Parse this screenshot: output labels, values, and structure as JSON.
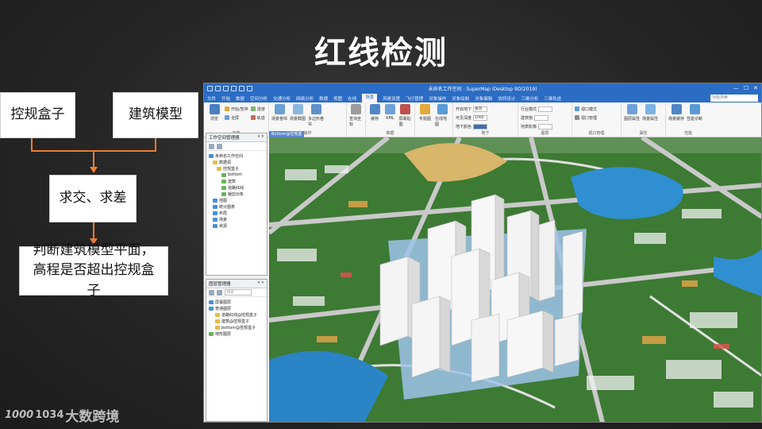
{
  "slide": {
    "title": "红线检测"
  },
  "flowchart": {
    "box_left": "控规盒子",
    "box_right": "建筑模型",
    "box_mid": "求交、求差",
    "box_bottom": "判断建筑模型平面，高程是否超出控规盒子",
    "arrow_color": "#ed7d31"
  },
  "app": {
    "window_title": "未命名工作空间 - SuperMap iDesktop 9D(2019)",
    "menu_items": [
      "文件",
      "开始",
      "数据",
      "空间分析",
      "交通分析",
      "网络分析",
      "数据",
      "视图",
      "在线",
      "场景",
      "风格设置",
      "飞行管理",
      "对象操作",
      "对象绘制",
      "对象编辑",
      "协同设计",
      "三维分析",
      "三维轨迹"
    ],
    "active_menu": "场景",
    "search_placeholder": "功能搜索",
    "ribbon": {
      "group_labels": [
        "浏览",
        "操作",
        "数据",
        "地下",
        "图层",
        "视口管理",
        "属性",
        "性能"
      ],
      "buttons": [
        "浏览",
        "场景卷帘",
        "场景截图",
        "多边形卷帘",
        "查询坐标",
        "缓存",
        "KML",
        "屏幕贴图",
        "专题图",
        "在线地图"
      ],
      "small_items": [
        "开始/暂停",
        "漫游",
        "全屏",
        "轨迹",
        "开启地下",
        "可见深度",
        "地下颜色",
        "行业模式",
        "建筑物",
        "地表影像",
        "视口模式",
        "视口管理",
        "图层属性",
        "场景属性",
        "场景缓存",
        "性能诊断"
      ],
      "open_value": "关闭",
      "depth_value": "1000"
    },
    "doc_tab": "Bottom@控规盒子",
    "workspace_panel": {
      "title": "工作空间管理器",
      "tree": [
        "未命名工作空间",
        "数据源",
        "控规盒子",
        "bottom",
        "建筑",
        "道路红线",
        "裁剪对象",
        "地图",
        "统计图表",
        "布局",
        "场景",
        "资源"
      ]
    },
    "layer_panel": {
      "title": "图层管理器",
      "search_placeholder": "搜索",
      "tree": [
        "屏幕图层",
        "普通图层",
        "道路红线@控规盒子",
        "建筑@控规盒子",
        "bottom@控规盒子",
        "地形图层"
      ]
    }
  },
  "watermark": {
    "logo": "1000",
    "number": "1034",
    "text": "大数跨境"
  }
}
